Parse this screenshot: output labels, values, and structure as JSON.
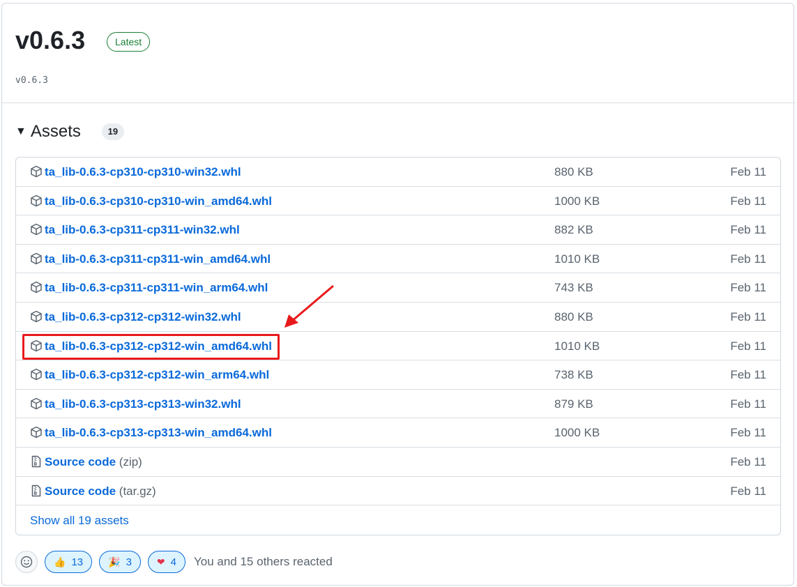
{
  "release": {
    "title": "v0.6.3",
    "badge": "Latest",
    "tag": "v0.6.3"
  },
  "assets": {
    "title": "Assets",
    "count": "19",
    "items": [
      {
        "name": "ta_lib-0.6.3-cp310-cp310-win32.whl",
        "suffix": "",
        "size": "880 KB",
        "date": "Feb 11",
        "icon": "package-icon"
      },
      {
        "name": "ta_lib-0.6.3-cp310-cp310-win_amd64.whl",
        "suffix": "",
        "size": "1000 KB",
        "date": "Feb 11",
        "icon": "package-icon"
      },
      {
        "name": "ta_lib-0.6.3-cp311-cp311-win32.whl",
        "suffix": "",
        "size": "882 KB",
        "date": "Feb 11",
        "icon": "package-icon"
      },
      {
        "name": "ta_lib-0.6.3-cp311-cp311-win_amd64.whl",
        "suffix": "",
        "size": "1010 KB",
        "date": "Feb 11",
        "icon": "package-icon"
      },
      {
        "name": "ta_lib-0.6.3-cp311-cp311-win_arm64.whl",
        "suffix": "",
        "size": "743 KB",
        "date": "Feb 11",
        "icon": "package-icon"
      },
      {
        "name": "ta_lib-0.6.3-cp312-cp312-win32.whl",
        "suffix": "",
        "size": "880 KB",
        "date": "Feb 11",
        "icon": "package-icon"
      },
      {
        "name": "ta_lib-0.6.3-cp312-cp312-win_amd64.whl",
        "suffix": "",
        "size": "1010 KB",
        "date": "Feb 11",
        "icon": "package-icon"
      },
      {
        "name": "ta_lib-0.6.3-cp312-cp312-win_arm64.whl",
        "suffix": "",
        "size": "738 KB",
        "date": "Feb 11",
        "icon": "package-icon"
      },
      {
        "name": "ta_lib-0.6.3-cp313-cp313-win32.whl",
        "suffix": "",
        "size": "879 KB",
        "date": "Feb 11",
        "icon": "package-icon"
      },
      {
        "name": "ta_lib-0.6.3-cp313-cp313-win_amd64.whl",
        "suffix": "",
        "size": "1000 KB",
        "date": "Feb 11",
        "icon": "package-icon"
      },
      {
        "name": "Source code",
        "suffix": "(zip)",
        "size": "",
        "date": "Feb 11",
        "icon": "file-zip-icon"
      },
      {
        "name": "Source code",
        "suffix": "(tar.gz)",
        "size": "",
        "date": "Feb 11",
        "icon": "file-zip-icon"
      }
    ],
    "show_all": "Show all 19 assets"
  },
  "reactions": {
    "items": [
      {
        "emoji": "👍",
        "count": "13",
        "icon": "thumbs-up-icon"
      },
      {
        "emoji": "🎉",
        "count": "3",
        "icon": "party-popper-icon"
      },
      {
        "emoji": "❤",
        "count": "4",
        "icon": "heart-icon"
      }
    ],
    "summary": "You and 15 others reacted"
  },
  "colors": {
    "link": "#0969da",
    "highlight": "#e8191c",
    "latest": "#1a7f37"
  }
}
